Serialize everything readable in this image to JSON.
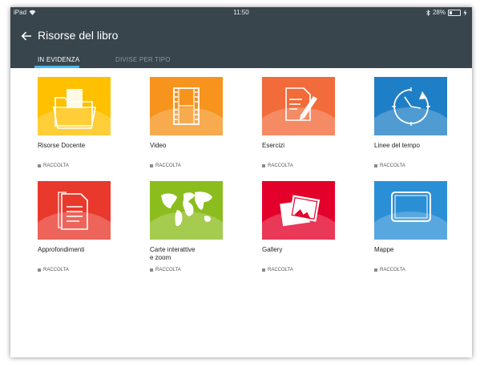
{
  "status": {
    "device": "iPad",
    "time": "11:50",
    "battery": "28%",
    "battery_level": 0.28
  },
  "header": {
    "title": "Risorse del libro",
    "back_icon": "arrow-left-icon"
  },
  "tabs": [
    {
      "label": "IN EVIDENZA",
      "active": true
    },
    {
      "label": "DIVISE PER TIPO",
      "active": false
    }
  ],
  "cards": [
    {
      "title": "Risorse Docente",
      "meta": "RACCOLTA",
      "color": "#ffc000",
      "icon": "folder-icon"
    },
    {
      "title": "Video",
      "meta": "RACCOLTA",
      "color": "#f7941d",
      "icon": "film-icon"
    },
    {
      "title": "Esercizi",
      "meta": "RACCOLTA",
      "color": "#f26b3a",
      "icon": "pencil-note-icon"
    },
    {
      "title": "Linee del tempo",
      "meta": "RACCOLTA",
      "color": "#1f7fc6",
      "icon": "clock-arrow-icon"
    },
    {
      "title": "Approfondimenti",
      "meta": "RACCOLTA",
      "color": "#e8392c",
      "icon": "document-icon"
    },
    {
      "title": "Carte interattive\ne zoom",
      "meta": "RACCOLTA",
      "color": "#8cbd1e",
      "icon": "world-map-icon"
    },
    {
      "title": "Gallery",
      "meta": "RACCOLTA",
      "color": "#e3002a",
      "icon": "photos-icon"
    },
    {
      "title": "Mappe",
      "meta": "RACCOLTA",
      "color": "#2b8fd6",
      "icon": "tablet-icon"
    }
  ]
}
